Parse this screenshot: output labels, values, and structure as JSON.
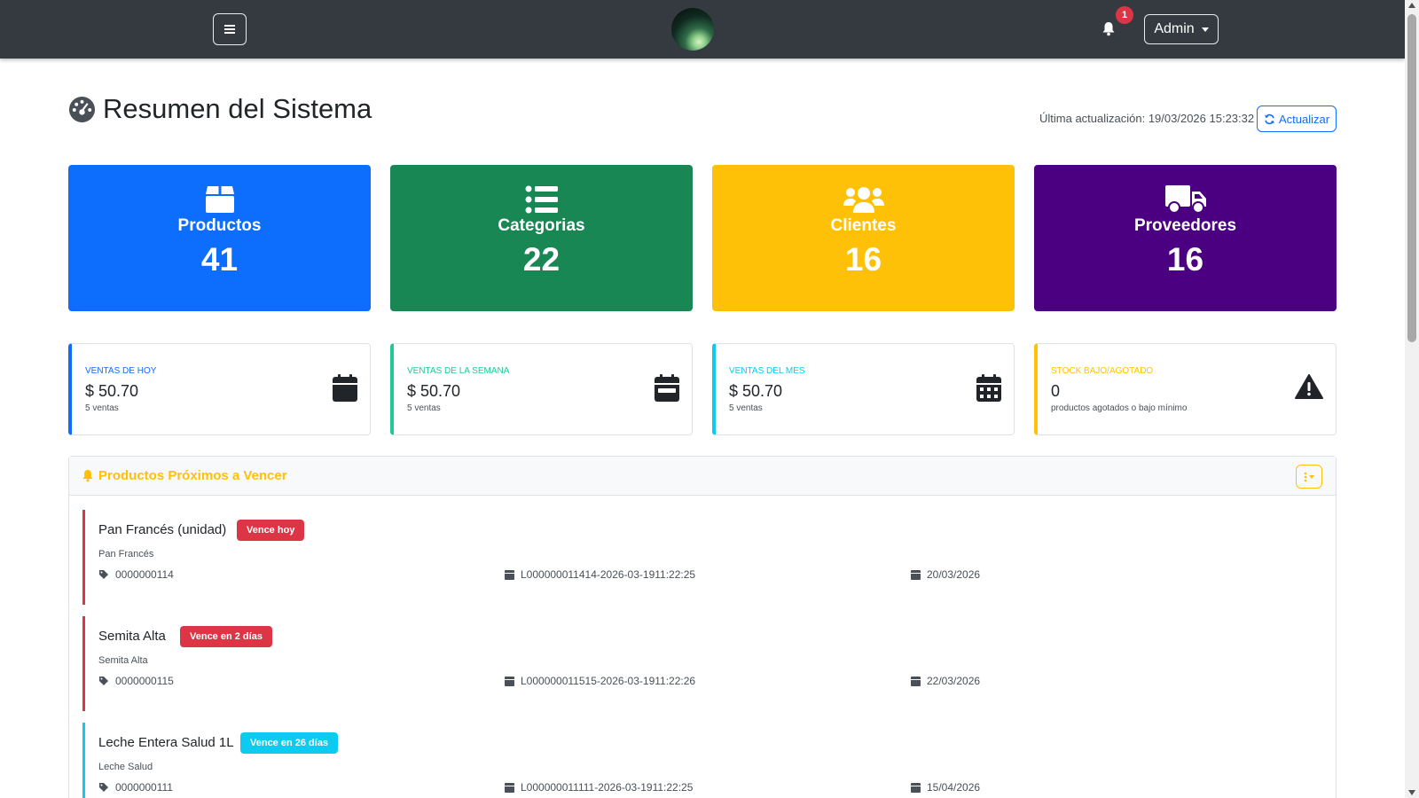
{
  "navbar": {
    "notifications_count": "1",
    "user_label": "Admin"
  },
  "header": {
    "title": "Resumen del Sistema",
    "last_update": "Última actualización: 19/03/2026 15:23:32",
    "refresh_label": "Actualizar"
  },
  "stats": [
    {
      "label": "Productos",
      "value": "41",
      "color": "#0d6efd",
      "icon": "box-icon"
    },
    {
      "label": "Categorias",
      "value": "22",
      "color": "#198754",
      "icon": "list-icon"
    },
    {
      "label": "Clientes",
      "value": "16",
      "color": "#ffc107",
      "icon": "users-icon"
    },
    {
      "label": "Proveedores",
      "value": "16",
      "color": "#4b0082",
      "icon": "truck-icon"
    }
  ],
  "sales": [
    {
      "label": "VENTAS DE HOY",
      "value": "$ 50.70",
      "sub": "5 ventas",
      "color": "#0d6efd",
      "icon": "calendar-icon"
    },
    {
      "label": "VENTAS DE LA SEMANA",
      "value": "$ 50.70",
      "sub": "5 ventas",
      "color": "#20c997",
      "icon": "calendar-week-icon"
    },
    {
      "label": "VENTAS DEL MES",
      "value": "$ 50.70",
      "sub": "5 ventas",
      "color": "#0dcaf0",
      "icon": "calendar-days-icon"
    },
    {
      "label": "STOCK BAJO/AGOTADO",
      "value": "0",
      "sub": "productos agotados o bajo mínimo",
      "color": "#ffc107",
      "icon": "warning-icon"
    }
  ],
  "expiring": {
    "title": "Productos Próximos a Vencer",
    "items": [
      {
        "name": "Pan Francés (unidad)",
        "badge": "Vence hoy",
        "badge_color": "#dc3545",
        "brand": "Pan Francés",
        "code": "0000000114",
        "lot": "L000000011414-2026-03-1911:22:25",
        "date": "20/03/2026"
      },
      {
        "name": "Semita Alta",
        "badge": "Vence en 2 días",
        "badge_color": "#dc3545",
        "brand": "Semita Alta",
        "code": "0000000115",
        "lot": "L000000011515-2026-03-1911:22:26",
        "date": "22/03/2026"
      },
      {
        "name": "Leche Entera Salud 1L",
        "badge": "Vence en 26 días",
        "badge_color": "#0dcaf0",
        "brand": "Leche Salud",
        "code": "0000000111",
        "lot": "L000000011111-2026-03-1911:22:25",
        "date": "15/04/2026"
      }
    ]
  }
}
